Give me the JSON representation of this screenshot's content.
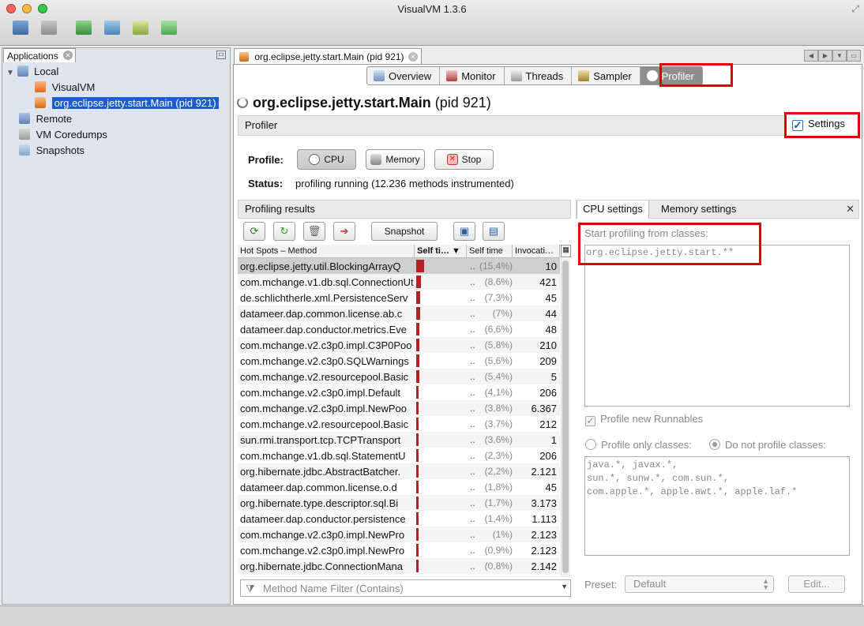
{
  "window": {
    "title": "VisualVM 1.3.6"
  },
  "left_panel": {
    "tab_label": "Applications",
    "tree": {
      "local": "Local",
      "visualvm": "VisualVM",
      "selected_app": "org.eclipse.jetty.start.Main (pid 921)",
      "remote": "Remote",
      "coredumps": "VM Coredumps",
      "snapshots": "Snapshots"
    }
  },
  "document_tab": {
    "label": "org.eclipse.jetty.start.Main (pid 921)"
  },
  "view_tabs": [
    "Overview",
    "Monitor",
    "Threads",
    "Sampler",
    "Profiler"
  ],
  "header": {
    "app_name": "org.eclipse.jetty.start.Main",
    "pid": "(pid 921)",
    "section": "Profiler",
    "settings_label": "Settings",
    "settings_checked": true
  },
  "profile": {
    "label": "Profile:",
    "cpu": "CPU",
    "memory": "Memory",
    "stop": "Stop",
    "status_label": "Status:",
    "status_text": "profiling running (12.236 methods instrumented)"
  },
  "results": {
    "title": "Profiling results",
    "snapshot_label": "Snapshot",
    "columns": [
      "Hot Spots – Method",
      "Self ti…",
      "Self time",
      "Invocati…"
    ],
    "rows": [
      {
        "method": "org.eclipse.jetty.util.BlockingArrayQ",
        "pct": "(15,4%)",
        "inv": "10",
        "frac": 0.154
      },
      {
        "method": "com.mchange.v1.db.sql.ConnectionUt",
        "pct": "(8,6%)",
        "inv": "421",
        "frac": 0.086
      },
      {
        "method": "de.schlichtherle.xml.PersistenceServ",
        "pct": "(7,3%)",
        "inv": "45",
        "frac": 0.073
      },
      {
        "method": "datameer.dap.common.license.ab.c",
        "pct": "(7%)",
        "inv": "44",
        "frac": 0.07
      },
      {
        "method": "datameer.dap.conductor.metrics.Eve",
        "pct": "(6,6%)",
        "inv": "48",
        "frac": 0.066
      },
      {
        "method": "com.mchange.v2.c3p0.impl.C3P0Poo",
        "pct": "(5,8%)",
        "inv": "210",
        "frac": 0.058
      },
      {
        "method": "com.mchange.v2.c3p0.SQLWarnings",
        "pct": "(5,6%)",
        "inv": "209",
        "frac": 0.056
      },
      {
        "method": "com.mchange.v2.resourcepool.Basic",
        "pct": "(5,4%)",
        "inv": "5",
        "frac": 0.054
      },
      {
        "method": "com.mchange.v2.c3p0.impl.Default",
        "pct": "(4,1%)",
        "inv": "206",
        "frac": 0.041
      },
      {
        "method": "com.mchange.v2.c3p0.impl.NewPoo",
        "pct": "(3,8%)",
        "inv": "6.367",
        "frac": 0.038
      },
      {
        "method": "com.mchange.v2.resourcepool.Basic",
        "pct": "(3,7%)",
        "inv": "212",
        "frac": 0.037
      },
      {
        "method": "sun.rmi.transport.tcp.TCPTransport",
        "pct": "(3,6%)",
        "inv": "1",
        "frac": 0.036
      },
      {
        "method": "com.mchange.v1.db.sql.StatementU",
        "pct": "(2,3%)",
        "inv": "206",
        "frac": 0.023
      },
      {
        "method": "org.hibernate.jdbc.AbstractBatcher.",
        "pct": "(2,2%)",
        "inv": "2.121",
        "frac": 0.022
      },
      {
        "method": "datameer.dap.common.license.o.d",
        "pct": "(1,8%)",
        "inv": "45",
        "frac": 0.018
      },
      {
        "method": "org.hibernate.type.descriptor.sql.Bi",
        "pct": "(1,7%)",
        "inv": "3.173",
        "frac": 0.017
      },
      {
        "method": "datameer.dap.conductor.persistence",
        "pct": "(1,4%)",
        "inv": "1.113",
        "frac": 0.014
      },
      {
        "method": "com.mchange.v2.c3p0.impl.NewPro",
        "pct": "(1%)",
        "inv": "2.123",
        "frac": 0.01
      },
      {
        "method": "com.mchange.v2.c3p0.impl.NewPro",
        "pct": "(0,9%)",
        "inv": "2.123",
        "frac": 0.009
      },
      {
        "method": "org.hibernate.jdbc.ConnectionMana",
        "pct": "(0,8%)",
        "inv": "2.142",
        "frac": 0.008
      }
    ],
    "filter_placeholder": "Method Name Filter (Contains)"
  },
  "settings_panel": {
    "tab_cpu": "CPU settings",
    "tab_memory": "Memory settings",
    "start_label": "Start profiling from classes:",
    "start_value": "org.eclipse.jetty.start.**",
    "profile_runnables": "Profile new Runnables",
    "profile_only": "Profile only classes:",
    "do_not_profile": "Do not profile classes:",
    "excluded_lines": [
      "java.*, javax.*,",
      "sun.*, sunw.*, com.sun.*,",
      "com.apple.*, apple.awt.*, apple.laf.*"
    ],
    "preset_label": "Preset:",
    "preset_value": "Default",
    "edit_label": "Edit..."
  }
}
